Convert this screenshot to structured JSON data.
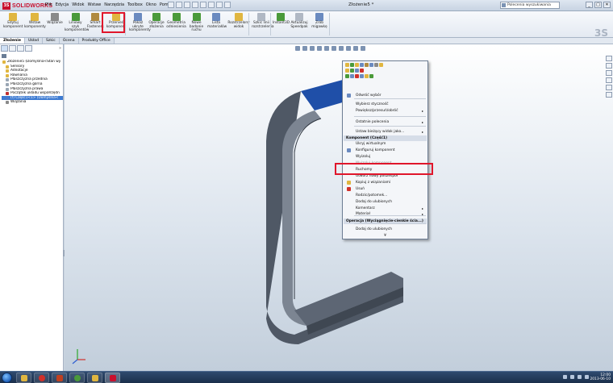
{
  "app": {
    "logo_text": "SOLIDWORKS",
    "title": "Złożenie5 *",
    "menu": [
      "Plik",
      "Edycja",
      "Widok",
      "Wstaw",
      "Narzędzia",
      "Toolbox",
      "Okno",
      "Pomoc"
    ],
    "search_placeholder": "Polecenia wyszukiwania",
    "window_buttons": [
      "_",
      "□",
      "✕"
    ]
  },
  "ribbon": {
    "buttons": [
      {
        "label": "Edytuj komponent",
        "icon": "edit-component-icon",
        "color": "#e0b640"
      },
      {
        "label": "Wstaw komponenty",
        "icon": "insert-components-icon",
        "color": "#e0b640"
      },
      {
        "label": "Wiązanie",
        "icon": "mate-icon",
        "color": "#8a8a8a"
      },
      {
        "label": "Liniowy szyk komponentów",
        "icon": "linear-pattern-icon",
        "color": "#4a9a3a"
      },
      {
        "label": "Smart Fasteners",
        "icon": "smart-fasteners-icon",
        "color": "#b08a40"
      },
      {
        "label": "Przenieś komponent",
        "icon": "move-component-icon",
        "color": "#e0b640"
      },
      {
        "label": "Pokaż ukryte komponenty",
        "icon": "show-hidden-icon",
        "color": "#6a8ac0"
      },
      {
        "label": "Operacje złożenia",
        "icon": "assembly-features-icon",
        "color": "#4a9a3a"
      },
      {
        "label": "Geometria odniesienia",
        "icon": "reference-geometry-icon",
        "color": "#4a9a3a"
      },
      {
        "label": "Nowe badanie ruchu",
        "icon": "motion-study-icon",
        "color": "#4a9a3a"
      },
      {
        "label": "Lista materiałów",
        "icon": "bom-icon",
        "color": "#6a8ac0"
      },
      {
        "label": "Rozstrzelony widok",
        "icon": "exploded-view-icon",
        "color": "#e0b640"
      },
      {
        "label": "Szkic linii rozstrzelenia",
        "icon": "explode-line-icon",
        "color": "#b0b8c4"
      },
      {
        "label": "Instant3D",
        "icon": "instant3d-icon",
        "color": "#4a9a3a"
      },
      {
        "label": "Aktualizuj Speedpak",
        "icon": "speedpak-icon",
        "color": "#b0b8c4"
      },
      {
        "label": "Zrób migawkę",
        "icon": "snapshot-icon",
        "color": "#6a8ac0"
      }
    ]
  },
  "tabs": [
    "Złożenie",
    "Układ",
    "Szkic",
    "Ocena",
    "Produkty Office"
  ],
  "tree": {
    "items": [
      {
        "label": "Złożenie5 (Domyślna<Stan wy",
        "icon": "assembly-icon",
        "color": "#e0b640",
        "root": true
      },
      {
        "label": "Sensory",
        "icon": "sensors-icon",
        "color": "#e0b640"
      },
      {
        "label": "Adnotacje",
        "icon": "annotations-icon",
        "color": "#e0b640"
      },
      {
        "label": "Równania",
        "icon": "equations-icon",
        "color": "#e0b640"
      },
      {
        "label": "Płaszczyzna przednia",
        "icon": "plane-icon",
        "color": "#9aa6b4"
      },
      {
        "label": "Płaszczyzna górna",
        "icon": "plane-icon",
        "color": "#9aa6b4"
      },
      {
        "label": "Płaszczyzna prawa",
        "icon": "plane-icon",
        "color": "#9aa6b4"
      },
      {
        "label": "Początek układu współrzędn",
        "icon": "origin-icon",
        "color": "#c03030"
      },
      {
        "label": "(f) Część1<1> (Domyślna<",
        "icon": "part-icon",
        "color": "#4a78c8",
        "selected": true
      },
      {
        "label": "Wiązania",
        "icon": "mates-icon",
        "color": "#8a8a8a"
      }
    ]
  },
  "context_menu": {
    "items": [
      {
        "label": "Odwróć wybór",
        "icon": "invert-selection-icon",
        "color": "#6a8ac0"
      },
      {
        "label": "Wybierz styczność",
        "icon": "",
        "color": ""
      },
      {
        "label": "Powiększ/przesuń/obróć",
        "icon": "",
        "color": "",
        "submenu": true
      },
      {
        "label": "Ostatnie polecenia",
        "icon": "",
        "color": "",
        "submenu": true
      },
      {
        "label": "Ustaw bieżący widok jako...",
        "icon": "",
        "color": "",
        "submenu": true
      },
      {
        "label": "Komponent (Część1)",
        "header": true
      },
      {
        "label": "Ukryj wirtualnym",
        "icon": "",
        "color": ""
      },
      {
        "label": "Konfiguruj komponent",
        "icon": "configure-icon",
        "color": "#6a8ac0"
      },
      {
        "label": "Wyizoluj",
        "icon": "",
        "color": ""
      },
      {
        "label": "Wyizoluj komponent",
        "icon": "",
        "color": "",
        "disabled": true
      },
      {
        "label": "Ruchomy",
        "icon": "",
        "color": ""
      },
      {
        "label": "Utwórz nowy podzespół",
        "icon": "",
        "color": ""
      },
      {
        "label": "Kopiuj z wiązaniami",
        "icon": "copy-mates-icon",
        "color": "#e0b640"
      },
      {
        "label": "Usuń",
        "icon": "delete-icon",
        "color": "#d0302a"
      },
      {
        "label": "Rodzic/potomek...",
        "icon": "",
        "color": ""
      },
      {
        "label": "Dodaj do ulubionych",
        "icon": "",
        "color": ""
      },
      {
        "label": "Komentarz",
        "icon": "",
        "color": "",
        "submenu": true
      },
      {
        "label": "Materiał",
        "icon": "",
        "color": "",
        "submenu": true
      },
      {
        "label": "Operacja (Wyciągnięcie-cienkie ścia...)",
        "header": true
      },
      {
        "label": "Dodaj do ulubionych",
        "icon": "",
        "color": ""
      },
      {
        "label": "¥",
        "icon": "",
        "color": "",
        "more": true
      }
    ]
  },
  "taskbar": {
    "time": "12:00",
    "date": "2013-06-10"
  },
  "colors": {
    "highlight": "#e0162b",
    "selection": "#3d7bd2",
    "model_face": "#1f4fa8",
    "model_body": "#5a6472"
  }
}
